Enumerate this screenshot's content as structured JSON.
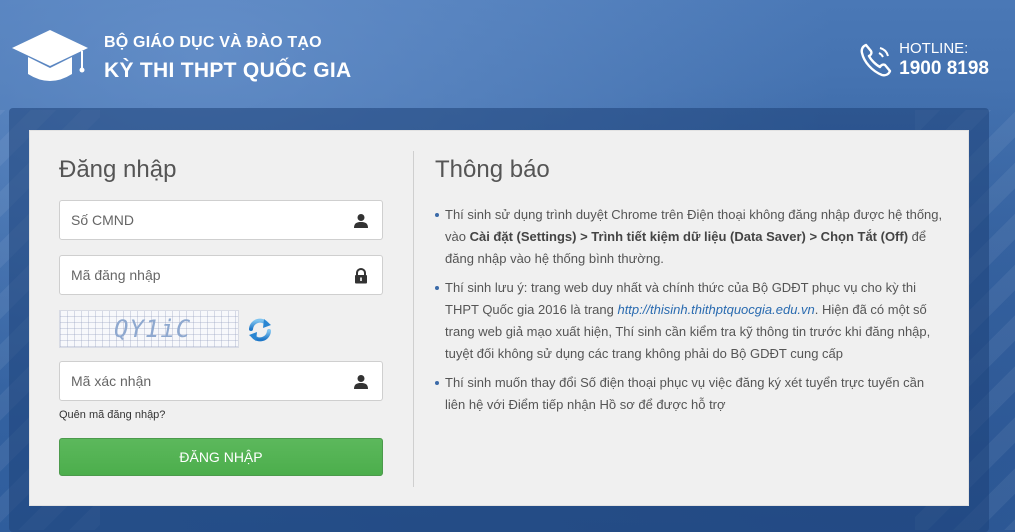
{
  "header": {
    "org_line1": "BỘ GIÁO DỤC VÀ ĐÀO TẠO",
    "org_line2": "KỲ THI THPT QUỐC GIA",
    "hotline_label": "HOTLINE:",
    "hotline_number": "1900 8198"
  },
  "login": {
    "title": "Đăng nhập",
    "id_placeholder": "Số CMND",
    "id_value": "",
    "code_placeholder": "Mã đăng nhập",
    "code_value": "",
    "captcha_text": "QY1iC",
    "confirm_placeholder": "Mã xác nhận",
    "confirm_value": "",
    "forgot_label": "Quên mã đăng nhập?",
    "submit_label": "ĐĂNG NHẬP"
  },
  "notice": {
    "title": "Thông báo",
    "item1_pre": "Thí sinh sử dụng trình duyệt Chrome trên Điện thoại không đăng nhập được hệ thống, vào ",
    "item1_bold1": "Cài đặt (Settings) > Trình tiết kiệm dữ liệu (Data Saver) > Chọn Tắt (Off)",
    "item1_post": " để đăng nhập vào hệ thống bình thường.",
    "item2_pre": "Thí sinh lưu ý: trang web duy nhất và chính thức của Bộ GDĐT phục vụ cho kỳ thi THPT Quốc gia 2016 là trang ",
    "item2_link": "http://thisinh.thithptquocgia.edu.vn",
    "item2_post": ". Hiện đã có một số trang web giả mạo xuất hiện, Thí sinh cần kiểm tra kỹ thông tin trước khi đăng nhập, tuyệt đối không sử dụng các trang không phải do Bộ GDĐT cung cấp",
    "item3": "Thí sinh muốn thay đổi Số điện thoại phục vụ việc đăng ký xét tuyển trực tuyến cần liên hệ với Điểm tiếp nhận Hồ sơ để được hỗ trợ"
  },
  "colors": {
    "background": "#3b6aa8",
    "panel": "#f0f0f0",
    "button": "#5cb85c",
    "link": "#2a6bb0"
  },
  "icons": {
    "logo": "graduation-cap-icon",
    "hotline": "phone-icon",
    "id_field": "user-icon",
    "code_field": "lock-icon",
    "captcha": "refresh-icon",
    "confirm_field": "user-icon"
  }
}
